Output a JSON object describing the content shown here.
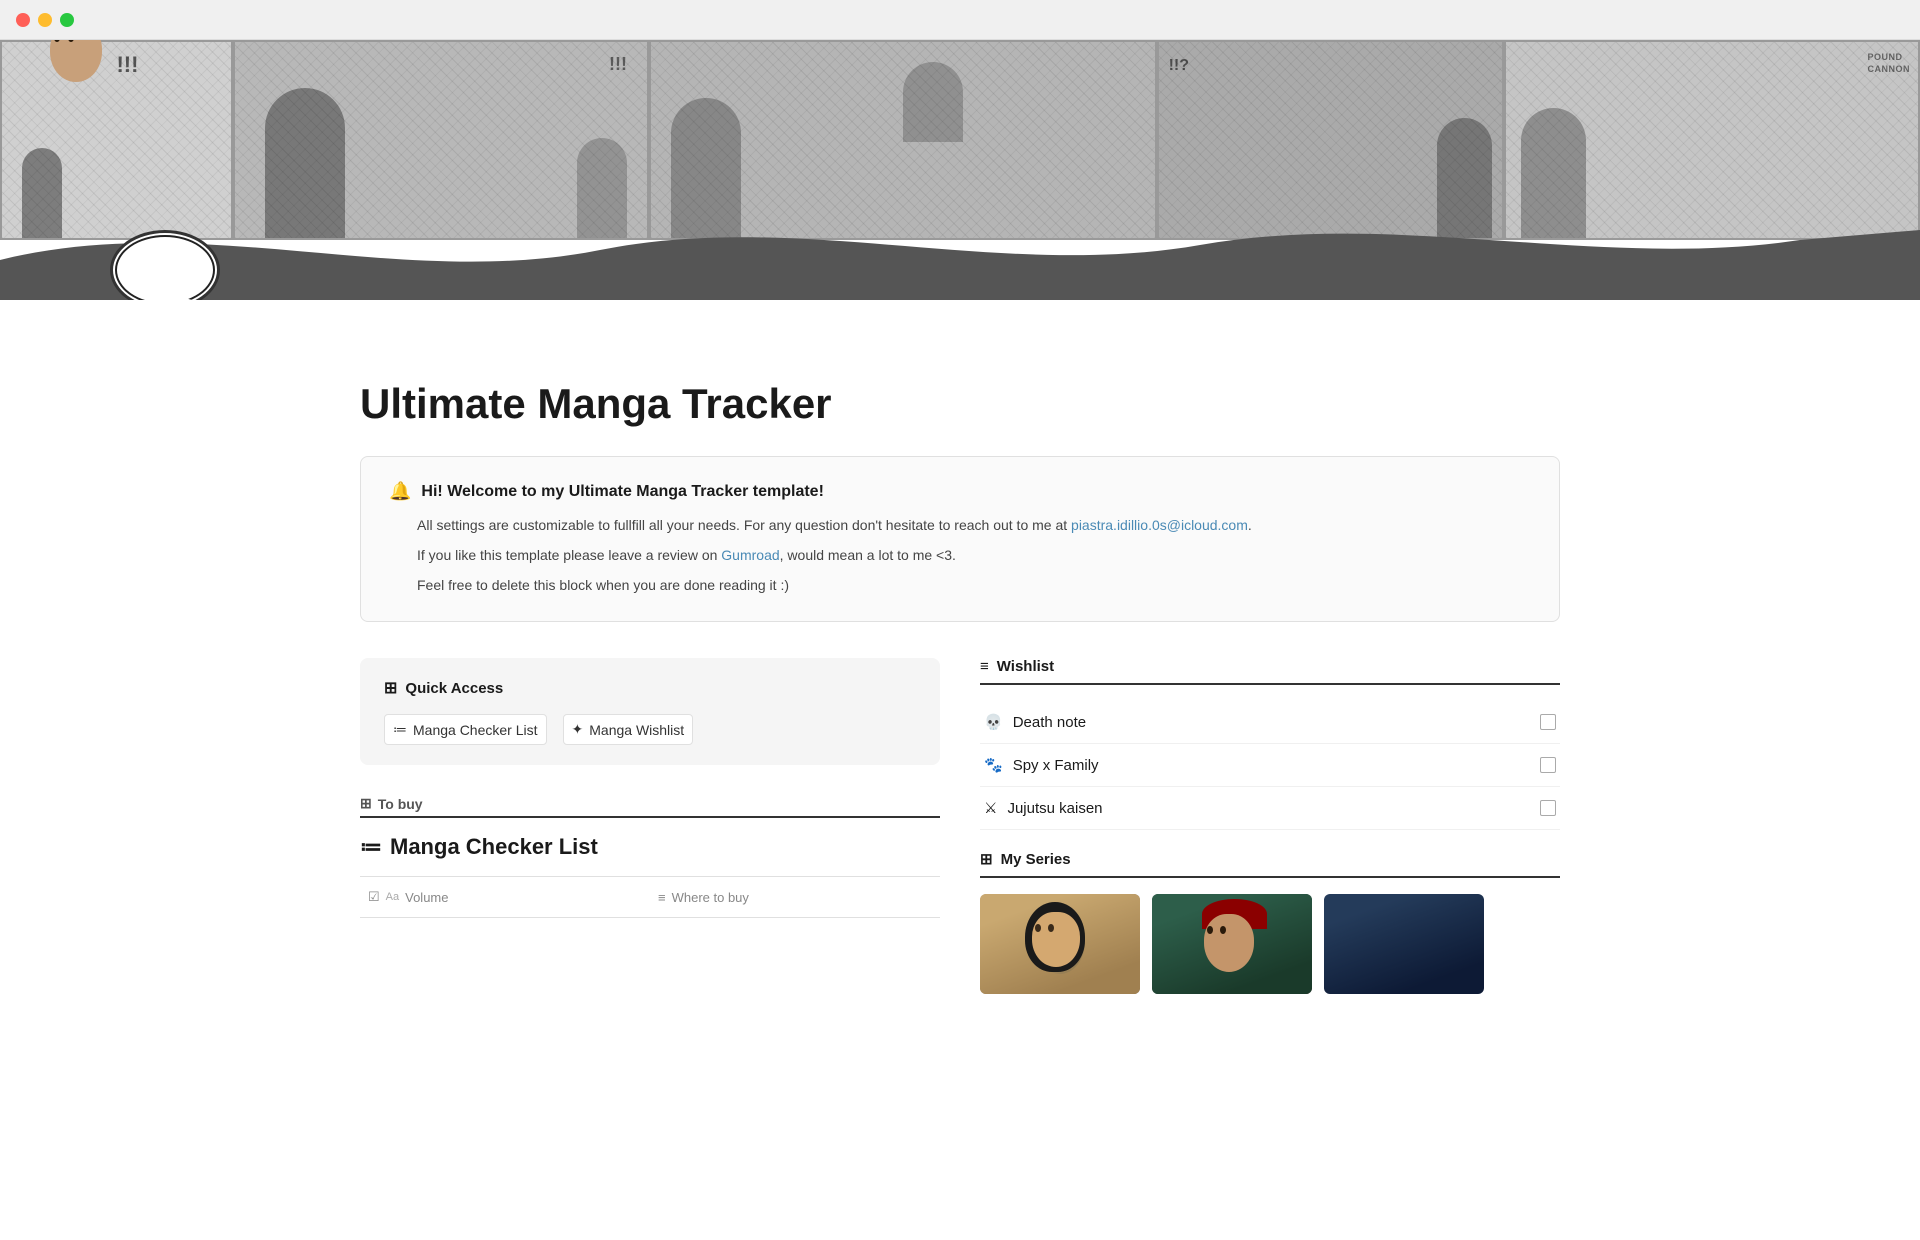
{
  "window": {
    "title": "Ultimate Manga Tracker"
  },
  "banner": {
    "panels": [
      {
        "id": 1,
        "text": "!!!"
      },
      {
        "id": 2,
        "text": ""
      },
      {
        "id": 3,
        "text": ""
      },
      {
        "id": 4,
        "text": "!!?"
      },
      {
        "id": 5,
        "text": "POUND CANNON"
      },
      {
        "id": 6,
        "text": ""
      }
    ]
  },
  "page": {
    "title": "Ultimate Manga Tracker",
    "emoji": "💬"
  },
  "welcome": {
    "bell_icon": "🔔",
    "title": "Hi! Welcome to my Ultimate Manga Tracker template!",
    "line1_before": "All settings are customizable to fullfill all your needs. For any question don't hesitate to reach out to me at ",
    "line1_email": "piastra.idillio.0s@icloud.com",
    "line1_after": ".",
    "line2_before": "If you like this template please leave a review on ",
    "line2_link": "Gumroad",
    "line2_after": ", would mean a lot to me <3.",
    "line3": "Feel free to delete this block when you are done reading it :)"
  },
  "quick_access": {
    "icon": "⊞",
    "title": "Quick Access",
    "links": [
      {
        "id": 1,
        "icon": "≔",
        "label": "Manga Checker List"
      },
      {
        "id": 2,
        "icon": "✦",
        "label": "Manga Wishlist"
      }
    ]
  },
  "to_buy": {
    "icon": "⊞",
    "label": "To buy"
  },
  "manga_checker": {
    "icon": "≔",
    "title": "Manga Checker List",
    "columns": [
      {
        "icon": "☑",
        "type": "Aa",
        "label": "Volume"
      },
      {
        "icon": "≡",
        "label": "Where to buy"
      }
    ]
  },
  "wishlist": {
    "icon": "≡",
    "title": "Wishlist",
    "items": [
      {
        "id": 1,
        "icon": "💀",
        "label": "Death note",
        "checked": false
      },
      {
        "id": 2,
        "icon": "🐾",
        "label": "Spy x Family",
        "checked": false
      },
      {
        "id": 3,
        "icon": "⚔",
        "label": "Jujutsu kaisen",
        "checked": false
      }
    ]
  },
  "my_series": {
    "icon": "⊞",
    "title": "My Series",
    "thumbnails": [
      {
        "id": 1,
        "alt": "Manga character 1",
        "color": "#b8956a"
      },
      {
        "id": 2,
        "alt": "Manga character 2",
        "color": "#2d4a3e"
      },
      {
        "id": 3,
        "alt": "Manga character 3",
        "color": "#1a2a4a"
      }
    ]
  }
}
